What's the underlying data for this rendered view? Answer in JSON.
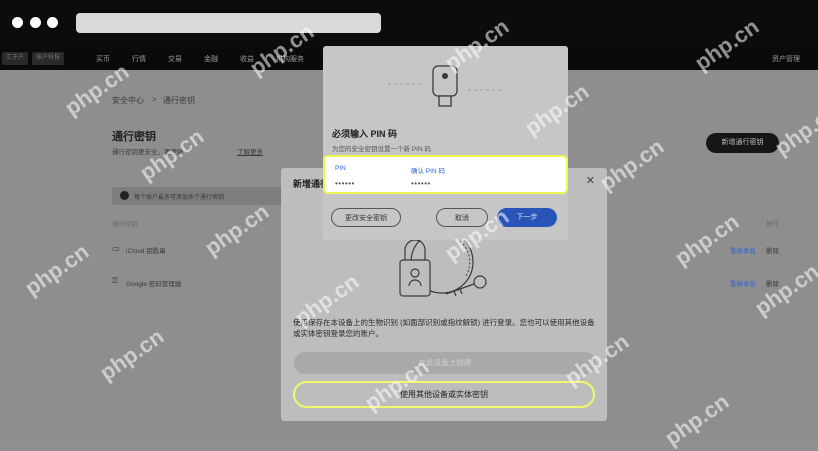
{
  "topnav": {
    "chip1": "汇于户",
    "chip2": "账户科技",
    "items": [
      "买币",
      "行情",
      "交易",
      "金融",
      "收益",
      "机构服务"
    ],
    "right": "资产管理"
  },
  "page": {
    "breadcrumb_home": "安全中心",
    "breadcrumb_sep": ">",
    "breadcrumb_current": "通行密钥",
    "heading": "通行密钥",
    "subheading": "通行密钥更安全，更便捷",
    "learn_more": "了解更多",
    "add_button": "新增通行密钥",
    "notice": "每个账户最多可添加多个通行密钥",
    "col_header": "通行密钥",
    "col_action": "操作",
    "rows": [
      {
        "name": "iCloud 钥匙串",
        "edit": "重新命名",
        "delete": "删除"
      },
      {
        "name": "Google 密码管理器",
        "edit": "重新命名",
        "delete": "删除"
      }
    ]
  },
  "modal": {
    "title": "新增通行密钥",
    "close": "✕",
    "description": "使用保存在本设备上的生物识别 (如面部识别或指纹解锁) 进行登录。您也可以使用其他设备或实体密钥登录您的账户。",
    "primary_button": "在此设备上创建",
    "secondary_button": "使用其他设备或实体密钥"
  },
  "pin_dialog": {
    "title": "必须输入 PIN 码",
    "subtitle": "为您的安全密钥设置一个新 PIN 码",
    "pin_label": "PIN",
    "pin_value": "••••••",
    "confirm_label": "确认 PIN 码",
    "confirm_value": "••••••",
    "change_key_button": "更改安全密钥",
    "cancel_button": "取消",
    "next_button": "下一步"
  },
  "watermarks": [
    "php.cn"
  ],
  "colors": {
    "highlight": "#eef74f",
    "accent": "#2f64d8"
  }
}
